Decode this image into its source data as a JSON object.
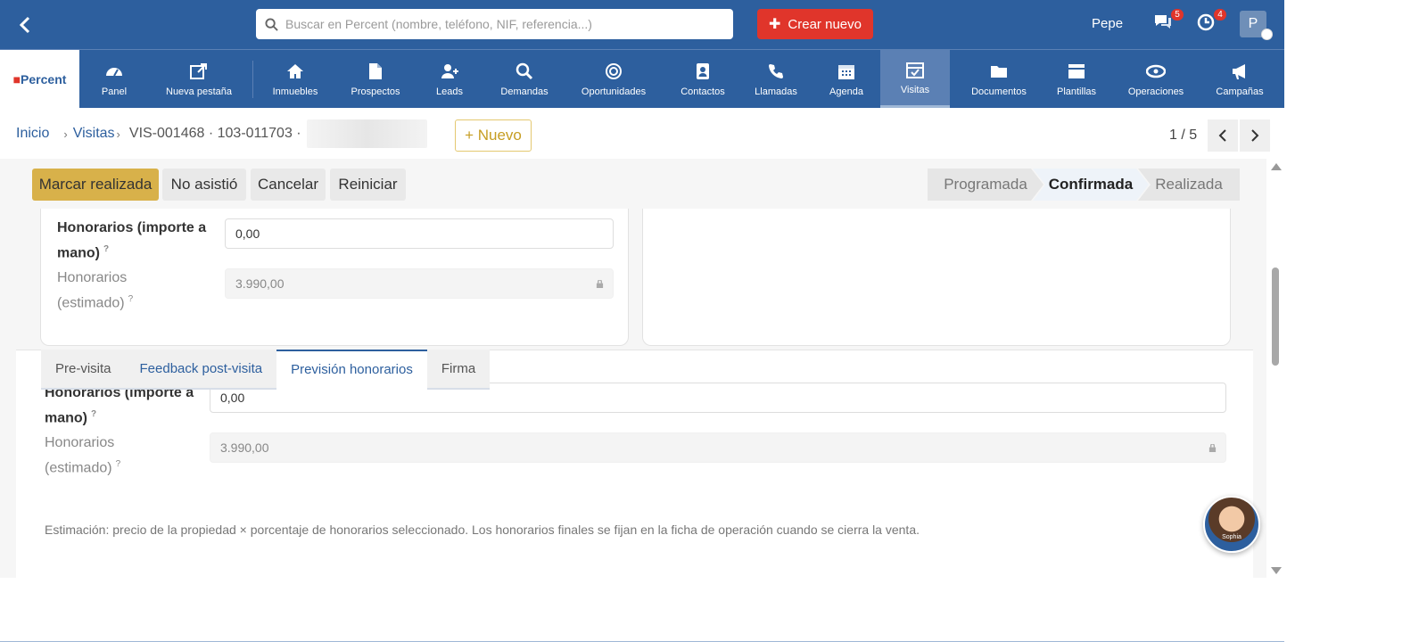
{
  "topbar": {
    "search_placeholder": "Buscar en Percent (nombre, teléfono, NIF, referencia...)",
    "crear_label": "Crear nuevo",
    "user_name": "Pepe",
    "chat_badge": "5",
    "notif_badge": "4",
    "avatar_letter": "P"
  },
  "nav": {
    "logo_text": "Percent",
    "items": [
      {
        "label": "Panel",
        "icon": "dashboard-icon"
      },
      {
        "label": "Nueva pestaña",
        "icon": "new-tab-icon"
      },
      {
        "label": "Inmuebles",
        "icon": "home-icon"
      },
      {
        "label": "Prospectos",
        "icon": "document-icon"
      },
      {
        "label": "Leads",
        "icon": "user-plus-icon"
      },
      {
        "label": "Demandas",
        "icon": "search-icon"
      },
      {
        "label": "Oportunidades",
        "icon": "target-icon"
      },
      {
        "label": "Contactos",
        "icon": "contact-icon"
      },
      {
        "label": "Llamadas",
        "icon": "phone-icon"
      },
      {
        "label": "Agenda",
        "icon": "calendar-icon"
      },
      {
        "label": "Visitas",
        "icon": "calendar-check-icon"
      },
      {
        "label": "Documentos",
        "icon": "folder-icon"
      },
      {
        "label": "Plantillas",
        "icon": "template-icon"
      },
      {
        "label": "Operaciones",
        "icon": "handshake-icon"
      },
      {
        "label": "Campañas",
        "icon": "megaphone-icon"
      }
    ],
    "active": "Visitas"
  },
  "breadcrumb": {
    "home": "Inicio",
    "section": "Visitas",
    "reference": "VIS-001468 · 103-011703 ·",
    "new_label": "+ Nuevo",
    "pager": "1 / 5"
  },
  "actions": {
    "mark_done": "Marcar realizada",
    "no_show": "No asistió",
    "cancel": "Cancelar",
    "restart": "Reiniciar"
  },
  "stages": [
    "Programada",
    "Confirmada",
    "Realizada"
  ],
  "current_stage": "Confirmada",
  "upper_card": {
    "fee_label_1": "Honorarios (importe a",
    "fee_label_2": "mano)",
    "fee_value": "0,00",
    "est_label_1": "Honorarios",
    "est_label_2": "(estimado)",
    "est_value": "3.990,00"
  },
  "tabs": [
    "Pre-visita",
    "Feedback post-visita",
    "Previsión honorarios",
    "Firma"
  ],
  "active_tab": "Previsión honorarios",
  "tab_panel": {
    "fee_label_1": "Honorarios (importe a",
    "fee_label_2": "mano)",
    "fee_value": "0,00",
    "est_label_1": "Honorarios",
    "est_label_2": "(estimado)",
    "est_value": "3.990,00",
    "note": "Estimación: precio de la propiedad × porcentaje de honorarios seleccionado. Los honorarios finales se fijan en la ficha de operación cuando se cierra la venta."
  },
  "help_mark": "?",
  "assistant": {
    "name": "Sophia"
  },
  "colors": {
    "primary": "#2d5f9e",
    "accent": "#e0352b",
    "warning": "#d8b14a"
  }
}
